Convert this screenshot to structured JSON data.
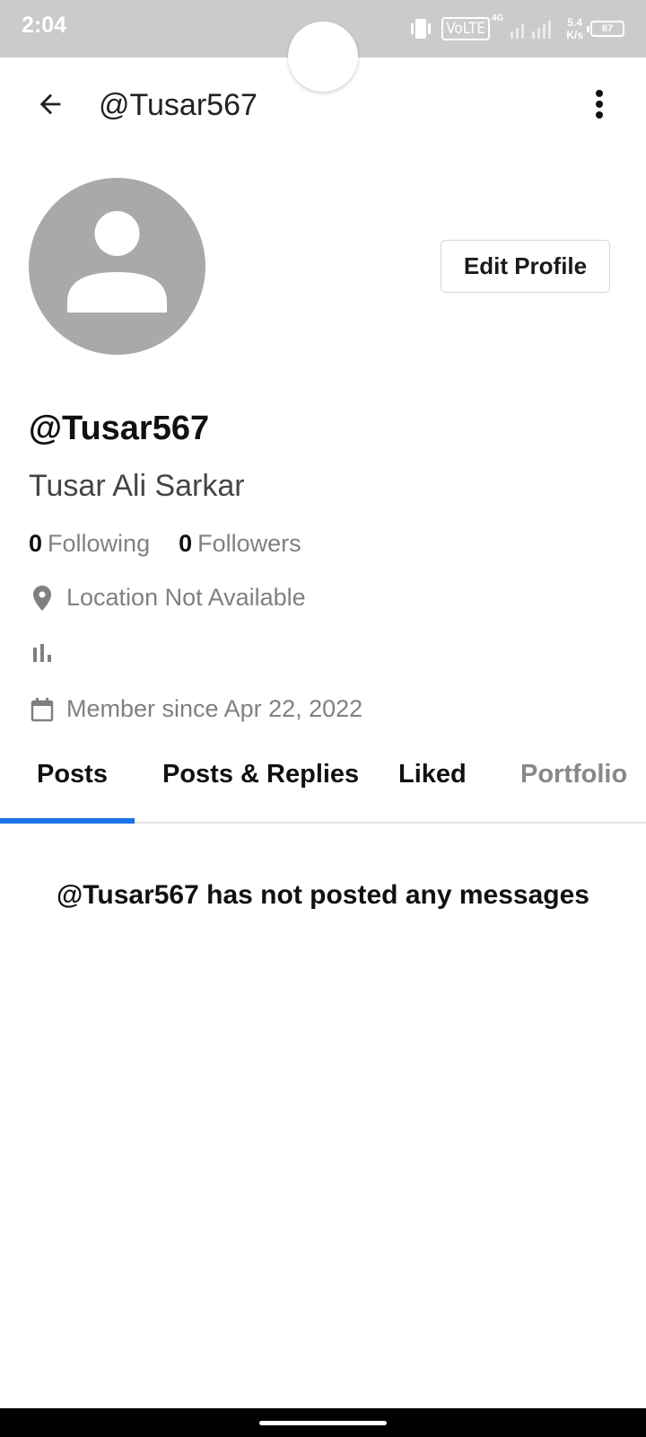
{
  "status_bar": {
    "time": "2:04",
    "volte": "VoLTE",
    "network": "4G",
    "speed_value": "5.4",
    "speed_unit": "K/s",
    "battery": "87",
    "icons": [
      "vibrate-icon",
      "signal-icon",
      "battery-icon"
    ]
  },
  "app_bar": {
    "title": "@Tusar567",
    "back_icon": "arrow-left-icon",
    "more_icon": "more-vert-icon"
  },
  "profile": {
    "avatar_icon": "person-icon",
    "edit_button": "Edit Profile",
    "handle": "@Tusar567",
    "name": "Tusar Ali Sarkar",
    "following_count": "0",
    "following_label": "Following",
    "followers_count": "0",
    "followers_label": "Followers",
    "location": "Location Not Available",
    "member_since": "Member since Apr 22, 2022"
  },
  "tabs": [
    {
      "label": "Posts",
      "active": true
    },
    {
      "label": "Posts & Replies",
      "active": false
    },
    {
      "label": "Liked",
      "active": false
    },
    {
      "label": "Portfolio",
      "active": false
    }
  ],
  "empty_state": "@Tusar567 has not posted any messages",
  "colors": {
    "accent": "#1a73e8",
    "status_bar": "#cacccb",
    "avatar": "#a9a9a9",
    "muted_text": "#808080"
  }
}
